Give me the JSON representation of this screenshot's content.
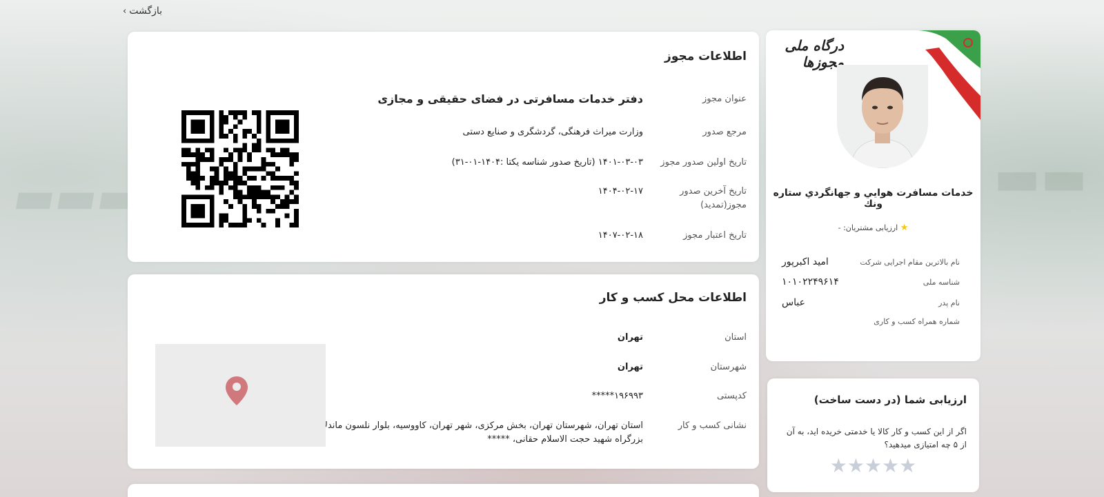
{
  "nav": {
    "back_label": "بازگشت"
  },
  "license": {
    "title": "اطلاعات مجوز",
    "rows": [
      {
        "label": "عنوان مجوز",
        "value": "دفتر خدمات مسافرتی در فضای حقیقی و مجازی"
      },
      {
        "label": "مرجع صدور",
        "value": "وزارت میراث فرهنگی، گردشگری و صنایع دستی"
      },
      {
        "label": "تاریخ اولین صدور مجوز",
        "value": "۱۴۰۱-۰۳-۰۳ (تاریخ صدور شناسه یکتا :۱۴۰۴-۰۱-۳۱)"
      },
      {
        "label": "تاریخ آخرین صدور مجوز(تمدید)",
        "value": "۱۴۰۴-۰۲-۱۷"
      },
      {
        "label": "تاریخ اعتبار مجوز",
        "value": "۱۴۰۷-۰۲-۱۸"
      }
    ]
  },
  "location": {
    "title": "اطلاعات محل کسب و کار",
    "rows": [
      {
        "label": "استان",
        "value": "تهران"
      },
      {
        "label": "شهرستان",
        "value": "تهران"
      },
      {
        "label": "کدپستی",
        "value": "۱۹۶۹۹۳*****"
      },
      {
        "label": "نشانی کسب و کار",
        "value": "استان تهران، شهرستان تهران، بخش مرکزی، شهر تهران، کاووسیه، بلوار نلسون ماندلا، بزرگراه شهید حجت الاسلام حقانی، *****"
      }
    ]
  },
  "profile": {
    "portal_logo": "درگاه ملی مجوزها",
    "company_name": "خدمات مسافرت هوايي و جهانگردي ستاره ونك",
    "rating_label": "ارزیابی مشتریان:",
    "rating_value": "-",
    "info": [
      {
        "label": "نام بالاترین مقام اجرایی شرکت",
        "value": "امید اکبرپور"
      },
      {
        "label": "شناسه ملی",
        "value": "۱۰۱۰۲۲۴۹۶۱۴"
      },
      {
        "label": "نام پدر",
        "value": "عباس"
      },
      {
        "label": "شماره همراه کسب و کاری",
        "value": ""
      }
    ]
  },
  "your_rating": {
    "title": "ارزیابی شما (در دست ساخت)",
    "description": "اگر از این کسب و کار کالا یا خدمتی خریده اید، به آن از ۵ چه امتیازی میدهید؟",
    "stars_total": 5
  },
  "colors": {
    "star_empty": "#c9cfd8",
    "star_filled": "#f5c518",
    "map_pin": "#d0787c"
  }
}
